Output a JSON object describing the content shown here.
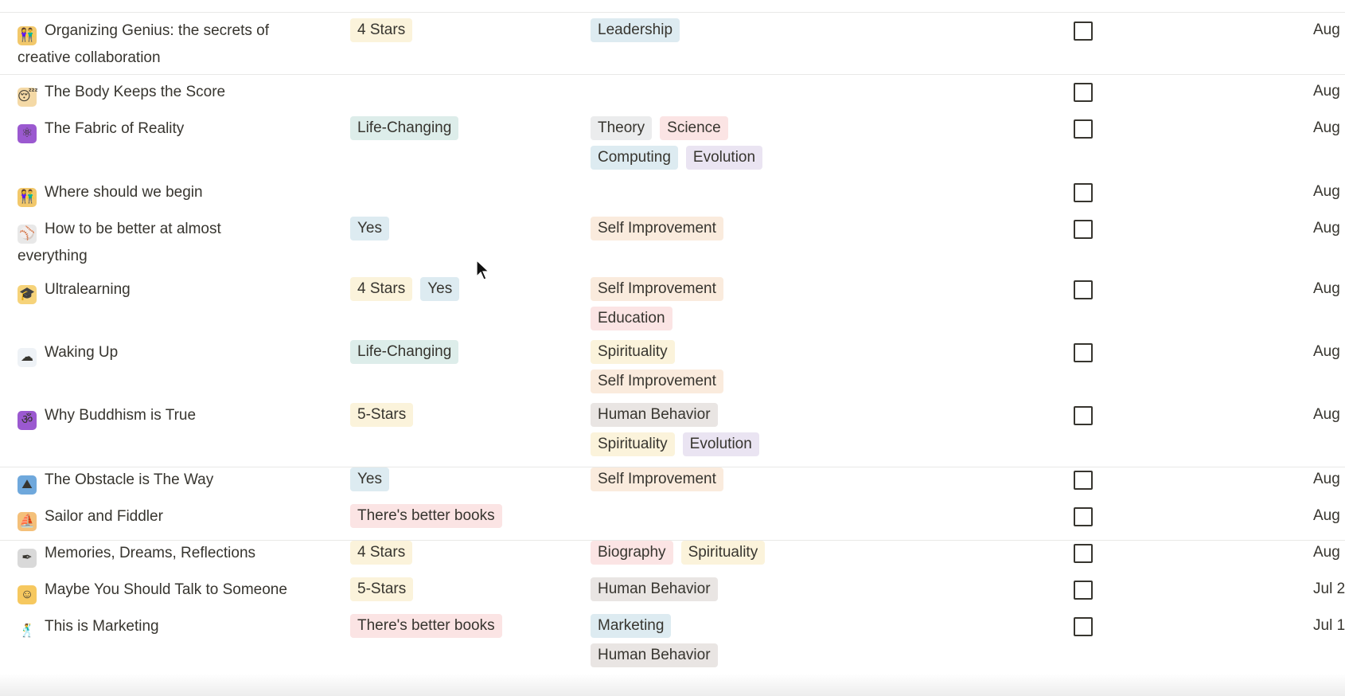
{
  "colors": {
    "tag_yellow": "#fbf3db",
    "tag_gray": "#ebeced",
    "tag_blue": "#ddebf1",
    "tag_red": "#fbe4e4",
    "tag_purple": "#eae4f2",
    "tag_orange": "#faebdd",
    "tag_green": "#ddedea",
    "tag_brown": "#e9e5e3"
  },
  "rows": [
    {
      "title": [
        "Organizing Genius: the secrets of",
        "creative collaboration"
      ],
      "icon": "couple-icon",
      "ratings": [
        {
          "label": "4 Stars",
          "color": "#fbf3db"
        }
      ],
      "tags": [
        [
          {
            "label": "Leadership",
            "color": "#ddebf1"
          }
        ]
      ],
      "date": "Aug"
    },
    {
      "title": [
        "The Body Keeps the Score"
      ],
      "icon": "sleeping-person-icon",
      "ratings": [],
      "tags": [],
      "date": "Aug"
    },
    {
      "title": [
        "The Fabric of Reality"
      ],
      "icon": "atom-icon",
      "ratings": [
        {
          "label": "Life-Changing",
          "color": "#ddedea"
        }
      ],
      "tags": [
        [
          {
            "label": "Theory",
            "color": "#ebeced"
          },
          {
            "label": "Science",
            "color": "#fbe4e4"
          }
        ],
        [
          {
            "label": "Computing",
            "color": "#ddebf1"
          },
          {
            "label": "Evolution",
            "color": "#eae4f2"
          }
        ]
      ],
      "date": "Aug"
    },
    {
      "title": [
        "Where should we begin"
      ],
      "icon": "couple-icon",
      "ratings": [],
      "tags": [],
      "date": "Aug"
    },
    {
      "title": [
        "How to be better at almost",
        "everything"
      ],
      "icon": "baseball-icon",
      "ratings": [
        {
          "label": "Yes",
          "color": "#ddebf1"
        }
      ],
      "tags": [
        [
          {
            "label": "Self Improvement",
            "color": "#faebdd"
          }
        ]
      ],
      "date": "Aug"
    },
    {
      "title": [
        "Ultralearning"
      ],
      "icon": "student-icon",
      "ratings": [
        {
          "label": "4 Stars",
          "color": "#fbf3db"
        },
        {
          "label": "Yes",
          "color": "#ddebf1"
        }
      ],
      "tags": [
        [
          {
            "label": "Self Improvement",
            "color": "#faebdd"
          }
        ],
        [
          {
            "label": "Education",
            "color": "#fbe4e4"
          }
        ]
      ],
      "date": "Aug"
    },
    {
      "title": [
        "Waking Up"
      ],
      "icon": "cloud-icon",
      "ratings": [
        {
          "label": "Life-Changing",
          "color": "#ddedea"
        }
      ],
      "tags": [
        [
          {
            "label": "Spirituality",
            "color": "#fbf3db"
          }
        ],
        [
          {
            "label": "Self Improvement",
            "color": "#faebdd"
          }
        ]
      ],
      "date": "Aug"
    },
    {
      "title": [
        "Why Buddhism is True"
      ],
      "icon": "om-icon",
      "ratings": [
        {
          "label": "5-Stars",
          "color": "#fbf3db"
        }
      ],
      "tags": [
        [
          {
            "label": "Human Behavior",
            "color": "#e9e5e3"
          }
        ],
        [
          {
            "label": "Spirituality",
            "color": "#fbf3db"
          },
          {
            "label": "Evolution",
            "color": "#eae4f2"
          }
        ]
      ],
      "date": "Aug"
    },
    {
      "title": [
        "The Obstacle is The Way"
      ],
      "icon": "landscape-icon",
      "ratings": [
        {
          "label": "Yes",
          "color": "#ddebf1"
        }
      ],
      "tags": [
        [
          {
            "label": "Self Improvement",
            "color": "#faebdd"
          }
        ]
      ],
      "date": "Aug"
    },
    {
      "title": [
        "Sailor and Fiddler"
      ],
      "icon": "sailboat-icon",
      "ratings": [
        {
          "label": "There's better books",
          "color": "#fbe4e4"
        }
      ],
      "tags": [],
      "date": "Aug"
    },
    {
      "title": [
        "Memories, Dreams, Reflections"
      ],
      "icon": "feather-icon",
      "ratings": [
        {
          "label": "4 Stars",
          "color": "#fbf3db"
        }
      ],
      "tags": [
        [
          {
            "label": "Biography",
            "color": "#fbe4e4"
          },
          {
            "label": "Spirituality",
            "color": "#fbf3db"
          }
        ]
      ],
      "date": "Aug"
    },
    {
      "title": [
        "Maybe You Should Talk to Someone"
      ],
      "icon": "face-icon",
      "ratings": [
        {
          "label": "5-Stars",
          "color": "#fbf3db"
        }
      ],
      "tags": [
        [
          {
            "label": "Human Behavior",
            "color": "#e9e5e3"
          }
        ]
      ],
      "date": "Jul 2"
    },
    {
      "title": [
        "This is Marketing"
      ],
      "icon": "dancer-icon",
      "ratings": [
        {
          "label": "There's better books",
          "color": "#fbe4e4"
        }
      ],
      "tags": [
        [
          {
            "label": "Marketing",
            "color": "#ddebf1"
          }
        ],
        [
          {
            "label": "Human Behavior",
            "color": "#e9e5e3"
          }
        ]
      ],
      "date": "Jul 1"
    }
  ]
}
